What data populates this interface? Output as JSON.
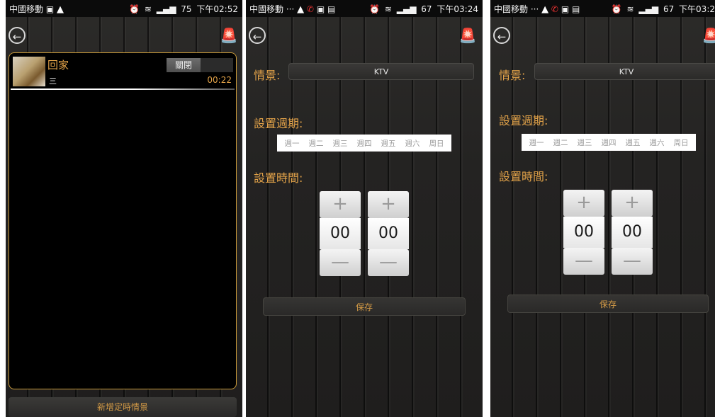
{
  "screen1": {
    "status": {
      "carrier": "中國移動",
      "gallery_icon": "▣",
      "warning_icon": "▲",
      "battery": "75",
      "time": "下午02:52"
    },
    "item": {
      "name": "回家",
      "toggle_label": "關閉",
      "days": "三",
      "time": "00:22"
    },
    "add_button": "新增定時情景"
  },
  "screen2": {
    "status": {
      "carrier": "中國移動 ···",
      "warning_icon": "▲",
      "battery": "67",
      "time": "下午03:24"
    },
    "scene_label": "情景:",
    "scene_value": "KTV",
    "period_label": "設置週期:",
    "weekdays": [
      "週一",
      "週二",
      "週三",
      "週四",
      "週五",
      "週六",
      "周日"
    ],
    "time_label": "設置時間:",
    "hour": "00",
    "minute": "00",
    "plus_symbol": "+",
    "minus_symbol": "—",
    "save_button": "保存"
  },
  "screen3": {
    "status": {
      "carrier": "中國移動 ···",
      "warning_icon": "▲",
      "battery": "67",
      "time": "下午03:2"
    },
    "scene_label": "情景:",
    "scene_value": "KTV",
    "period_label": "設置週期:",
    "weekdays": [
      "週一",
      "週二",
      "週三",
      "週四",
      "週五",
      "週六",
      "周日"
    ],
    "time_label": "設置時間:",
    "hour": "00",
    "minute": "00",
    "plus_symbol": "+",
    "minus_symbol": "—",
    "save_button": "保存"
  },
  "icons": {
    "back": "back-arrow-icon",
    "alarm": "siren-alarm-icon"
  },
  "colors": {
    "accent": "#e3a349",
    "panel_border": "#c99a3a"
  }
}
